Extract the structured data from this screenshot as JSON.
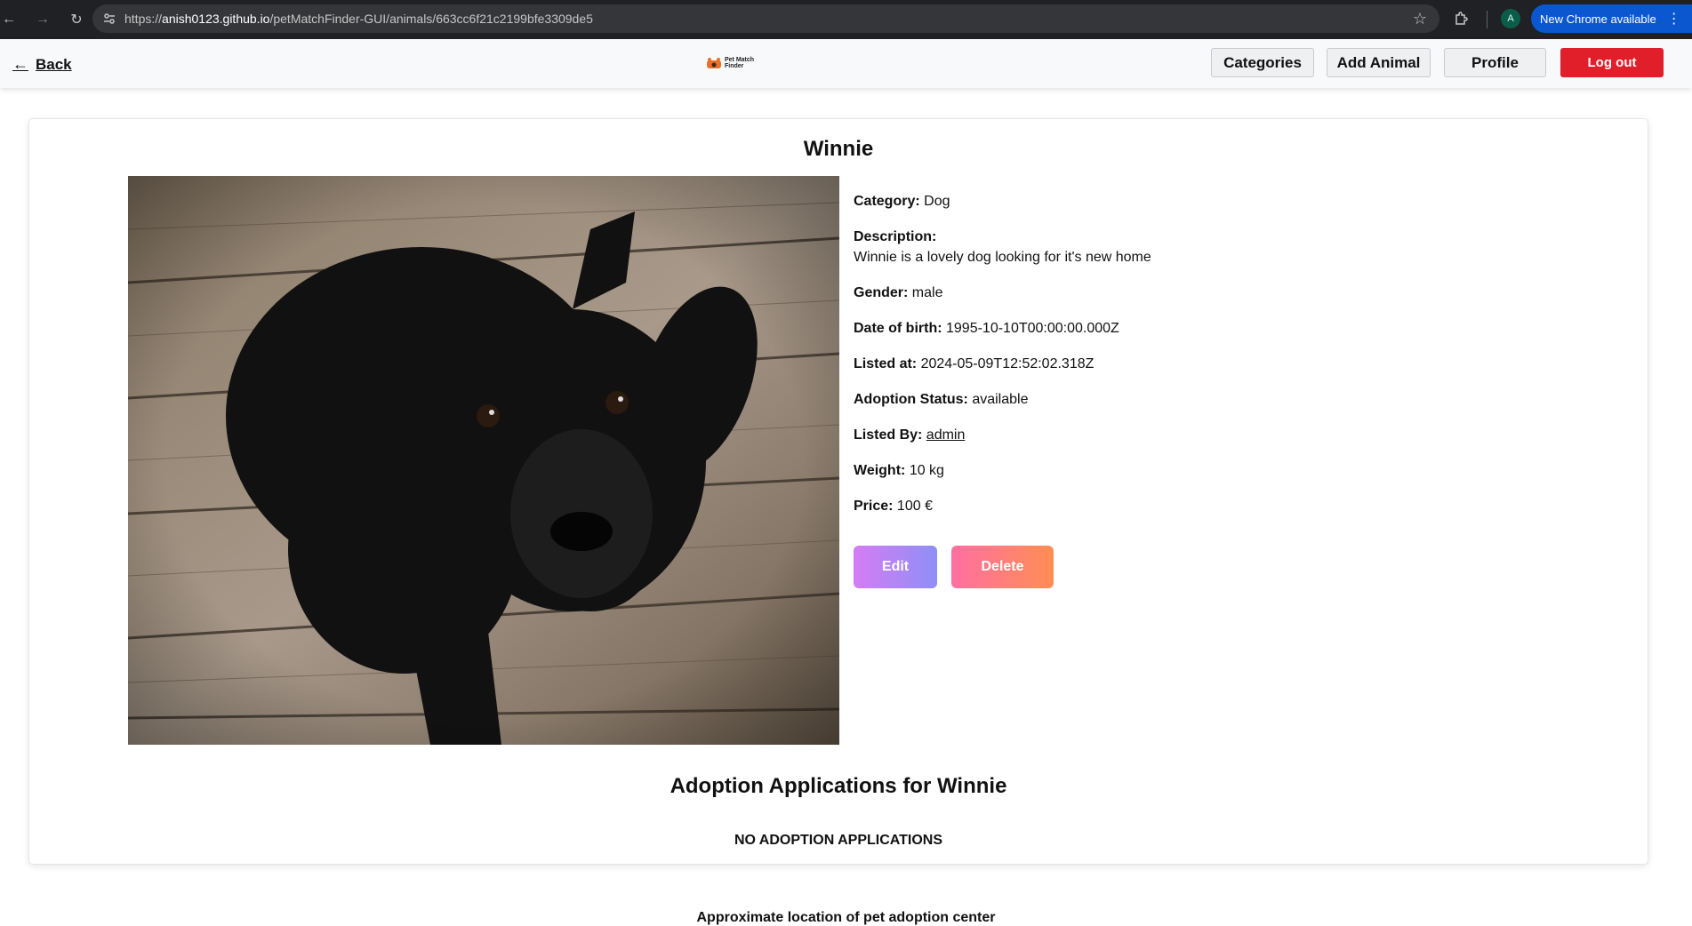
{
  "browser": {
    "url_prefix": "https://",
    "url_host": "anish0123.github.io",
    "url_path": "/petMatchFinder-GUI/animals/663cc6f21c2199bfe3309de5",
    "profile_initial": "A",
    "update_label": "New Chrome available"
  },
  "header": {
    "back_label": "Back",
    "logo_text_line1": "Pet Match",
    "logo_text_line2": "Finder",
    "nav": {
      "categories": "Categories",
      "add_animal": "Add Animal",
      "profile": "Profile",
      "logout": "Log out"
    }
  },
  "animal": {
    "name": "Winnie",
    "fields": {
      "category_label": "Category:",
      "category": "Dog",
      "description_label": "Description:",
      "description": "Winnie is a lovely dog looking for it's new home",
      "gender_label": "Gender:",
      "gender": "male",
      "dob_label": "Date of birth:",
      "dob": "1995-10-10T00:00:00.000Z",
      "listed_at_label": "Listed at:",
      "listed_at": "2024-05-09T12:52:02.318Z",
      "status_label": "Adoption Status:",
      "status": "available",
      "listed_by_label": "Listed By:",
      "listed_by": "admin",
      "weight_label": "Weight:",
      "weight": "10 kg",
      "price_label": "Price:",
      "price": "100 €"
    },
    "actions": {
      "edit": "Edit",
      "delete": "Delete"
    }
  },
  "applications": {
    "title": "Adoption Applications for Winnie",
    "empty_text": "NO ADOPTION APPLICATIONS"
  },
  "map": {
    "label": "Approximate location of pet adoption center"
  },
  "colors": {
    "logout_bg": "#e01f2a",
    "update_pill": "#0b57d0",
    "edit_gradient": [
      "#d57cf4",
      "#8f8ff6"
    ],
    "delete_gradient": [
      "#ff6fa3",
      "#ff8e52"
    ]
  }
}
